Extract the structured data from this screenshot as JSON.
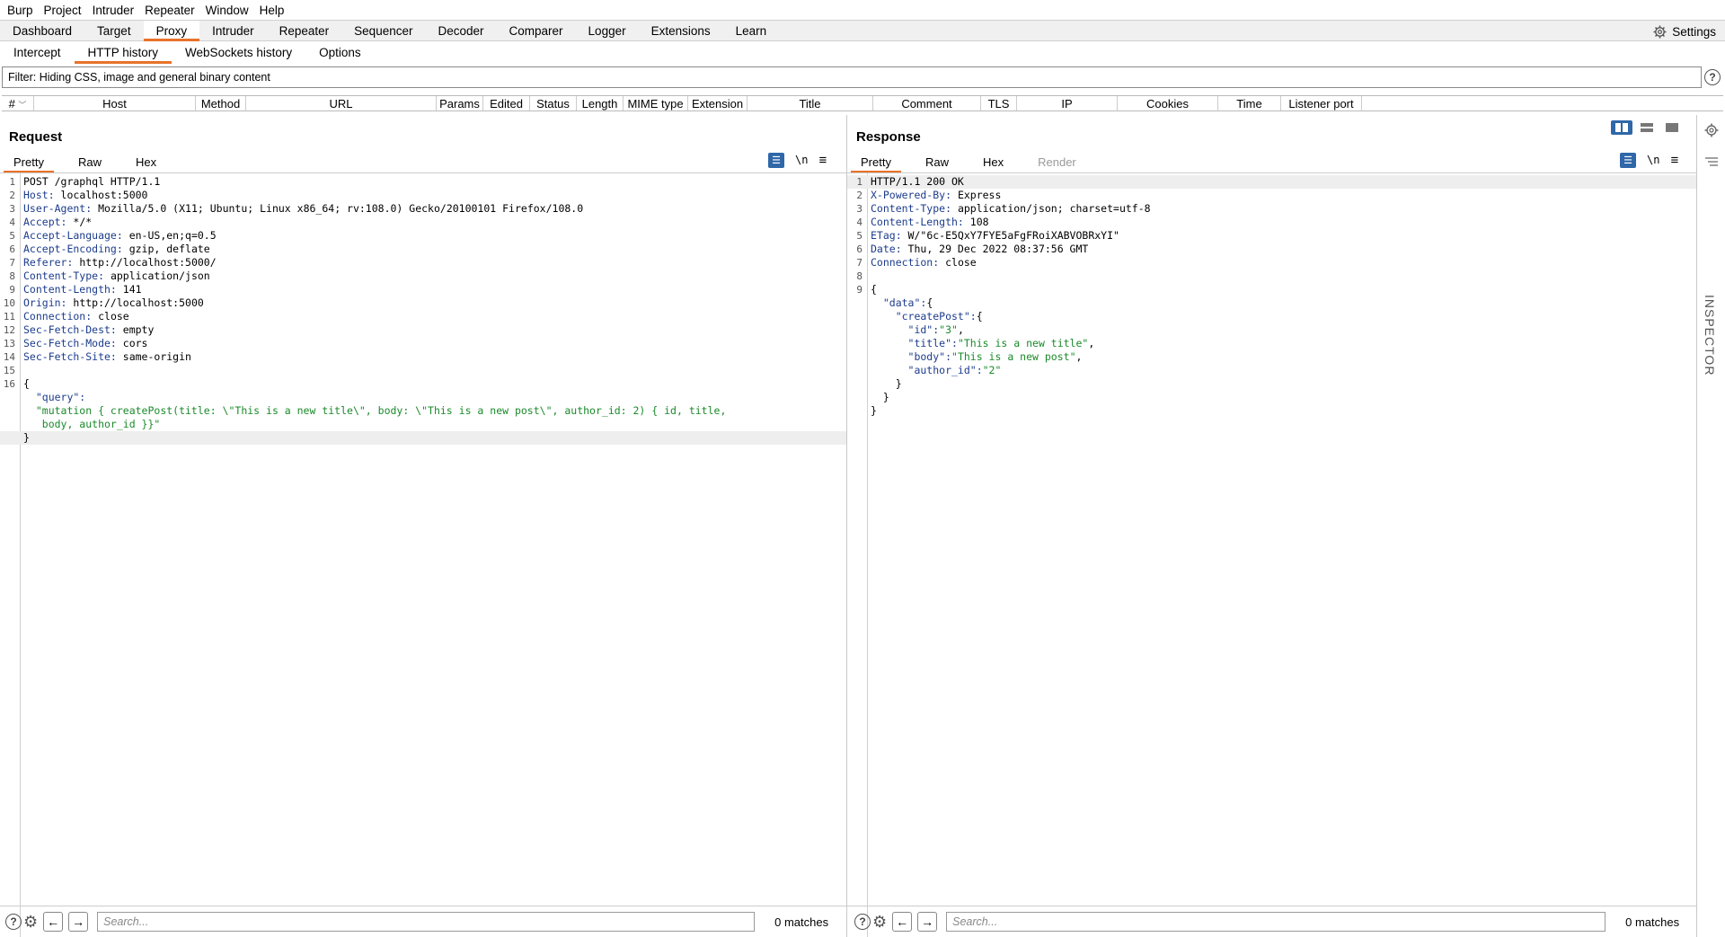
{
  "menu": [
    "Burp",
    "Project",
    "Intruder",
    "Repeater",
    "Window",
    "Help"
  ],
  "main_tabs": [
    "Dashboard",
    "Target",
    "Proxy",
    "Intruder",
    "Repeater",
    "Sequencer",
    "Decoder",
    "Comparer",
    "Logger",
    "Extensions",
    "Learn"
  ],
  "active_main_tab": "Proxy",
  "settings_label": "Settings",
  "sub_tabs": [
    "Intercept",
    "HTTP history",
    "WebSockets history",
    "Options"
  ],
  "active_sub_tab": "HTTP history",
  "filter_text": "Filter: Hiding CSS, image and general binary content",
  "columns": [
    "#",
    "Host",
    "Method",
    "URL",
    "Params",
    "Edited",
    "Status",
    "Length",
    "MIME type",
    "Extension",
    "Title",
    "Comment",
    "TLS",
    "IP",
    "Cookies",
    "Time",
    "Listener port"
  ],
  "request": {
    "title": "Request",
    "tabs": [
      "Pretty",
      "Raw",
      "Hex"
    ],
    "active_tab": "Pretty",
    "tools": {
      "newline": "\\n"
    },
    "lines": [
      {
        "n": "1",
        "text": "POST /graphql HTTP/1.1"
      },
      {
        "n": "2",
        "name": "Host:",
        "value": " localhost:5000"
      },
      {
        "n": "3",
        "name": "User-Agent:",
        "value": " Mozilla/5.0 (X11; Ubuntu; Linux x86_64; rv:108.0) Gecko/20100101 Firefox/108.0"
      },
      {
        "n": "4",
        "name": "Accept:",
        "value": " */*"
      },
      {
        "n": "5",
        "name": "Accept-Language:",
        "value": " en-US,en;q=0.5"
      },
      {
        "n": "6",
        "name": "Accept-Encoding:",
        "value": " gzip, deflate"
      },
      {
        "n": "7",
        "name": "Referer:",
        "value": " http://localhost:5000/"
      },
      {
        "n": "8",
        "name": "Content-Type:",
        "value": " application/json"
      },
      {
        "n": "9",
        "name": "Content-Length:",
        "value": " 141"
      },
      {
        "n": "10",
        "name": "Origin:",
        "value": " http://localhost:5000"
      },
      {
        "n": "11",
        "name": "Connection:",
        "value": " close"
      },
      {
        "n": "12",
        "name": "Sec-Fetch-Dest:",
        "value": " empty"
      },
      {
        "n": "13",
        "name": "Sec-Fetch-Mode:",
        "value": " cors"
      },
      {
        "n": "14",
        "name": "Sec-Fetch-Site:",
        "value": " same-origin"
      },
      {
        "n": "15",
        "text": ""
      },
      {
        "n": "16",
        "text": "{"
      },
      {
        "n": "",
        "key": "  \"query\":",
        "str": ""
      },
      {
        "n": "",
        "key": "",
        "str": "  \"mutation { createPost(title: \\\"This is a new title\\\", body: \\\"This is a new post\\\", author_id: 2) { id, title,"
      },
      {
        "n": "",
        "key": "",
        "str": "   body, author_id }}\""
      },
      {
        "n": "",
        "text": "}",
        "highlight": true
      }
    ],
    "search_placeholder": "Search...",
    "matches": "0 matches"
  },
  "response": {
    "title": "Response",
    "tabs": [
      "Pretty",
      "Raw",
      "Hex",
      "Render"
    ],
    "active_tab": "Pretty",
    "tools": {
      "newline": "\\n"
    },
    "lines": [
      {
        "n": "1",
        "text": "HTTP/1.1 200 OK",
        "highlight": true
      },
      {
        "n": "2",
        "name": "X-Powered-By:",
        "value": " Express"
      },
      {
        "n": "3",
        "name": "Content-Type:",
        "value": " application/json; charset=utf-8"
      },
      {
        "n": "4",
        "name": "Content-Length:",
        "value": " 108"
      },
      {
        "n": "5",
        "name": "ETag:",
        "value": " W/\"6c-E5QxY7FYE5aFgFRoiXABVOBRxYI\""
      },
      {
        "n": "6",
        "name": "Date:",
        "value": " Thu, 29 Dec 2022 08:37:56 GMT"
      },
      {
        "n": "7",
        "name": "Connection:",
        "value": " close"
      },
      {
        "n": "8",
        "text": ""
      },
      {
        "n": "9",
        "text": "{"
      },
      {
        "n": "",
        "key": "  \"data\":",
        "str": "",
        "tail": "{"
      },
      {
        "n": "",
        "key": "    \"createPost\":",
        "str": "",
        "tail": "{"
      },
      {
        "n": "",
        "key": "      \"id\":",
        "str": "\"3\"",
        "tail": ","
      },
      {
        "n": "",
        "key": "      \"title\":",
        "str": "\"This is a new title\"",
        "tail": ","
      },
      {
        "n": "",
        "key": "      \"body\":",
        "str": "\"This is a new post\"",
        "tail": ","
      },
      {
        "n": "",
        "key": "      \"author_id\":",
        "str": "\"2\"",
        "tail": ""
      },
      {
        "n": "",
        "text": "    }"
      },
      {
        "n": "",
        "text": "  }"
      },
      {
        "n": "",
        "text": "}"
      }
    ],
    "search_placeholder": "Search...",
    "matches": "0 matches"
  },
  "inspector_label": "INSPECTOR",
  "colors": {
    "accent": "#e8722a",
    "toggle_blue": "#2f67a8",
    "header_name": "#1c3c8c",
    "json_string": "#1a8a2a"
  }
}
